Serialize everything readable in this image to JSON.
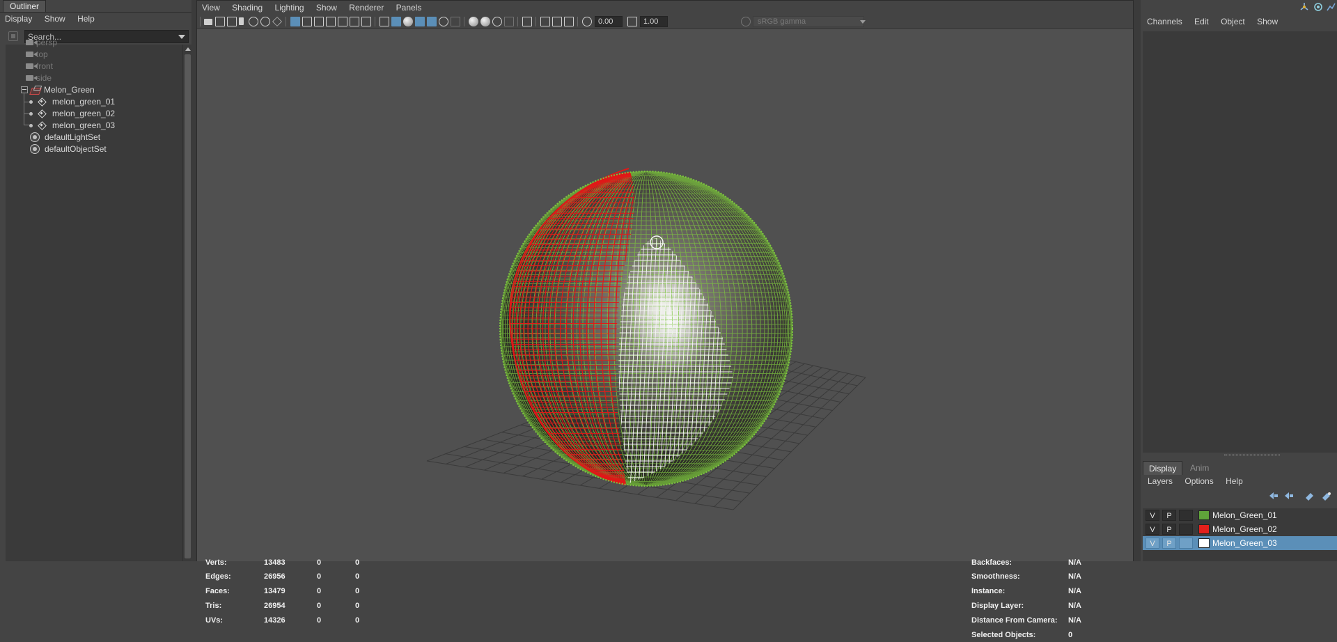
{
  "outliner": {
    "tab": "Outliner",
    "menu": [
      "Display",
      "Show",
      "Help"
    ],
    "search_placeholder": "Search...",
    "tree": {
      "cameras": [
        "persp",
        "top",
        "front",
        "side"
      ],
      "group": "Melon_Green",
      "children": [
        "melon_green_01",
        "melon_green_02",
        "melon_green_03"
      ],
      "sets": [
        "defaultLightSet",
        "defaultObjectSet"
      ]
    }
  },
  "viewport": {
    "menu": [
      "View",
      "Shading",
      "Lighting",
      "Show",
      "Renderer",
      "Panels"
    ],
    "toolbar": {
      "exposure": "0.00",
      "gamma": "1.00",
      "color_space": "sRGB gamma"
    },
    "hud_left": [
      {
        "label": "Verts:",
        "total": "13483",
        "sel": "0",
        "comp": "0"
      },
      {
        "label": "Edges:",
        "total": "26956",
        "sel": "0",
        "comp": "0"
      },
      {
        "label": "Faces:",
        "total": "13479",
        "sel": "0",
        "comp": "0"
      },
      {
        "label": "Tris:",
        "total": "26954",
        "sel": "0",
        "comp": "0"
      },
      {
        "label": "UVs:",
        "total": "14326",
        "sel": "0",
        "comp": "0"
      }
    ],
    "hud_right": [
      {
        "label": "Backfaces:",
        "value": "N/A"
      },
      {
        "label": "Smoothness:",
        "value": "N/A"
      },
      {
        "label": "Instance:",
        "value": "N/A"
      },
      {
        "label": "Display Layer:",
        "value": "N/A"
      },
      {
        "label": "Distance From Camera:",
        "value": "N/A"
      },
      {
        "label": "Selected Objects:",
        "value": "0"
      }
    ]
  },
  "channel_box": {
    "menu": [
      "Channels",
      "Edit",
      "Object",
      "Show"
    ]
  },
  "layer_editor": {
    "tabs": [
      "Display",
      "Anim"
    ],
    "menu": [
      "Layers",
      "Options",
      "Help"
    ],
    "layers": [
      {
        "v": "V",
        "p": "P",
        "name": "Melon_Green_01",
        "color": "#5fa33a"
      },
      {
        "v": "V",
        "p": "P",
        "name": "Melon_Green_02",
        "color": "#e3201b"
      },
      {
        "v": "V",
        "p": "P",
        "name": "Melon_Green_03",
        "color": "#ffffff"
      }
    ]
  },
  "colors": {
    "wire_red": "#e01818",
    "wire_green": "#7ec640",
    "wire_white": "#f5f5f5",
    "selection_blue": "#5b8fb8"
  }
}
